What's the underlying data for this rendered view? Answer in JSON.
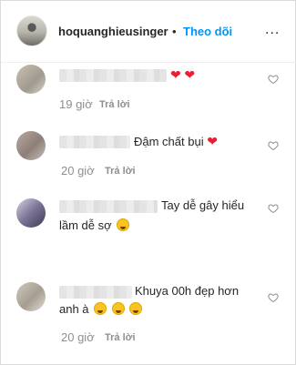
{
  "header": {
    "username": "hoquanghieusinger",
    "separator": "•",
    "follow_label": "Theo dõi",
    "more_label": "..."
  },
  "comments": [
    {
      "text": "",
      "time": "19 giờ",
      "reply_label": "Trả lời",
      "emojis": [
        "heart",
        "heart"
      ]
    },
    {
      "text": "Đậm chất bụi",
      "time": "20 giờ",
      "reply_label": "Trả lời",
      "emojis": [
        "heart"
      ]
    },
    {
      "text_line1": "Tay dễ gây hiểu",
      "text_line2": "lầm dễ sợ",
      "time": "20 giờ",
      "reply_label": "Trả lời",
      "emojis": [
        "laughing-face"
      ]
    },
    {
      "text_line1": "Khuya 00h đẹp hơn",
      "text_line2": "anh à",
      "time": "20 giờ",
      "reply_label": "Trả lời",
      "emojis": [
        "winking-face",
        "tongue-face",
        "grinning-sweat-face"
      ]
    }
  ],
  "colors": {
    "accent": "#0095f6",
    "muted_text": "#8e8e8e",
    "heart": "#ed1c2e"
  },
  "icons": {
    "like": "heart-outline-icon",
    "more": "more-options-icon"
  }
}
